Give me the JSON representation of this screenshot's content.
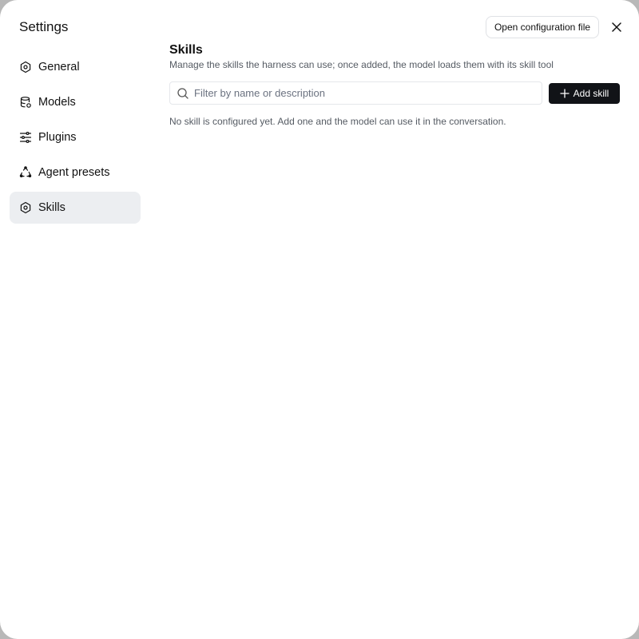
{
  "dialog": {
    "title": "Settings",
    "open_config_label": "Open configuration file"
  },
  "sidebar": {
    "items": [
      {
        "label": "General",
        "icon": "gear-icon",
        "active": false
      },
      {
        "label": "Models",
        "icon": "database-icon",
        "active": false
      },
      {
        "label": "Plugins",
        "icon": "sliders-icon",
        "active": false
      },
      {
        "label": "Agent presets",
        "icon": "recycle-icon",
        "active": false
      },
      {
        "label": "Skills",
        "icon": "gear-icon",
        "active": true
      }
    ]
  },
  "main": {
    "title": "Skills",
    "description": "Manage the skills the harness can use; once added, the model loads them with its skill tool",
    "search": {
      "placeholder": "Filter by name or description",
      "value": ""
    },
    "add_label": "Add skill",
    "empty_message": "No skill is configured yet. Add one and the model can use it in the conversation."
  },
  "colors": {
    "active_bg": "#eceef1",
    "primary_button": "#111317",
    "muted_text": "#555b63"
  }
}
